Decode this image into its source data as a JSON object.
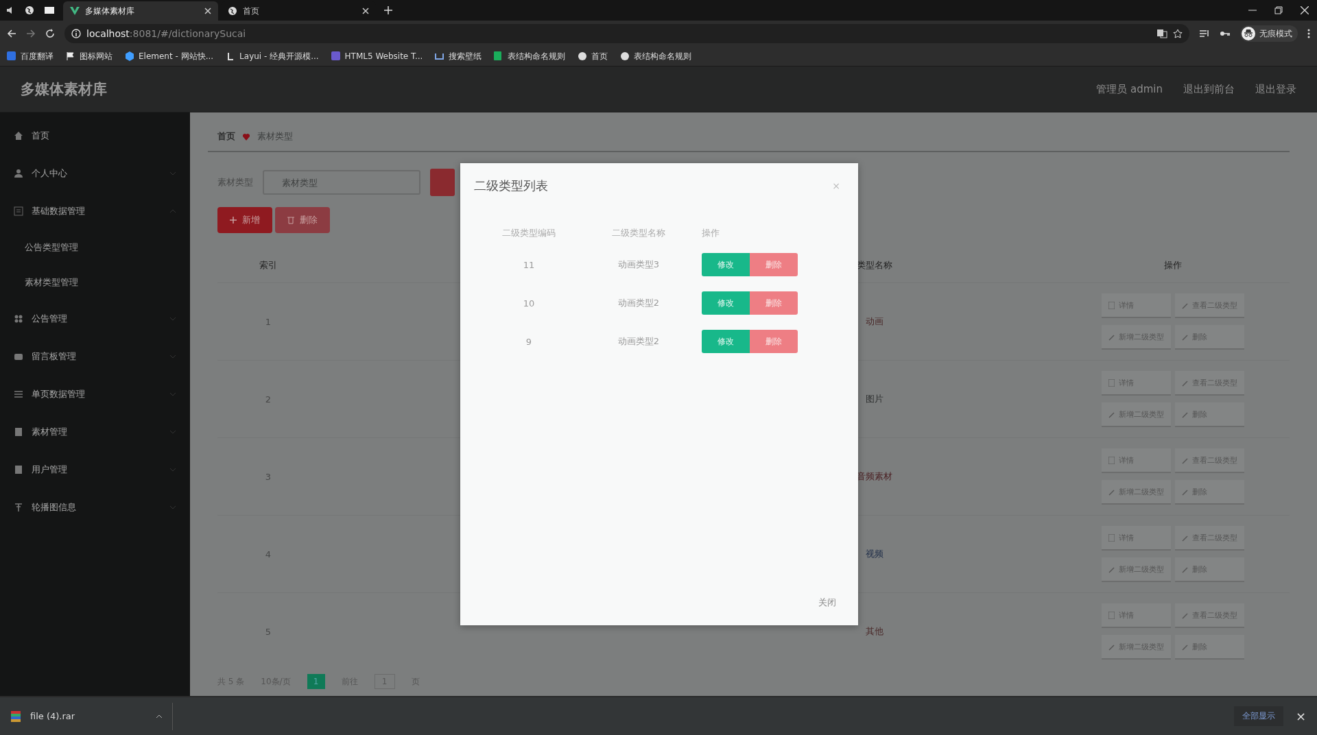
{
  "browser": {
    "tabs": [
      {
        "title": "多媒体素材库",
        "selected": true
      },
      {
        "title": "首页",
        "selected": false
      }
    ],
    "url_host": "localhost",
    "url_path": ":8081/#/dictionarySucai",
    "bookmarks": [
      "百度翻译",
      "图标网站",
      "Element - 网站快...",
      "Layui - 经典开源模...",
      "HTML5 Website T...",
      "搜索壁纸",
      "表结构命名规则",
      "首页",
      "表结构命名规则"
    ],
    "profile": "无痕模式"
  },
  "app": {
    "title": "多媒体素材库",
    "user": "管理员 admin",
    "links": [
      "退出到前台",
      "退出登录"
    ]
  },
  "sidebar": {
    "items": [
      {
        "label": "首页"
      },
      {
        "label": "个人中心",
        "expanded": false
      },
      {
        "label": "基础数据管理",
        "expanded": true,
        "children": [
          {
            "label": "公告类型管理"
          },
          {
            "label": "素材类型管理"
          }
        ]
      },
      {
        "label": "公告管理",
        "expanded": false
      },
      {
        "label": "留言板管理",
        "expanded": false
      },
      {
        "label": "单页数据管理",
        "expanded": false
      },
      {
        "label": "素材管理",
        "expanded": false
      },
      {
        "label": "用户管理",
        "expanded": false
      },
      {
        "label": "轮播图信息",
        "expanded": false
      }
    ]
  },
  "breadcrumb": [
    "首页",
    "素材类型"
  ],
  "search": {
    "label": "素材类型",
    "placeholder": "素材类型"
  },
  "toolbar": [
    "新增",
    "删除"
  ],
  "table": {
    "columns": [
      "索引",
      "类型名称",
      "操作"
    ],
    "rows": [
      {
        "index": "1",
        "name": "动画",
        "actions": [
          "详情",
          "查看二级类型",
          "新增二级类型",
          "删除"
        ]
      },
      {
        "index": "2",
        "name": "图片",
        "actions": [
          "详情",
          "查看二级类型",
          "新增二级类型",
          "删除"
        ]
      },
      {
        "index": "3",
        "name": "音频素材",
        "actions": [
          "详情",
          "查看二级类型",
          "新增二级类型",
          "删除"
        ]
      },
      {
        "index": "4",
        "name": "视频",
        "actions": [
          "详情",
          "查看二级类型",
          "新增二级类型",
          "删除"
        ]
      },
      {
        "index": "5",
        "name": "其他",
        "actions": [
          "详情",
          "查看二级类型",
          "新增二级类型",
          "删除"
        ]
      }
    ]
  },
  "pagination": {
    "total": "共 5 条",
    "page_size": "10条/页",
    "pages": [
      {
        "label": "1",
        "selected": true
      }
    ],
    "goto": "前往",
    "goto_value": "1",
    "unit": "页"
  },
  "modal": {
    "title": "二级类型列表",
    "close": "×",
    "columns": [
      "二级类型编码",
      "二级类型名称",
      "操作"
    ],
    "rows": [
      {
        "code": "11",
        "name": "动画类型3",
        "actions": [
          "修改",
          "删除"
        ]
      },
      {
        "code": "10",
        "name": "动画类型2",
        "actions": [
          "修改",
          "删除"
        ]
      },
      {
        "code": "9",
        "name": "动画类型2",
        "actions": [
          "修改",
          "删除"
        ]
      }
    ],
    "footer_button": "关闭"
  },
  "downloads": {
    "file": "file (4).rar",
    "show_all": "全部显示",
    "close": "×"
  }
}
